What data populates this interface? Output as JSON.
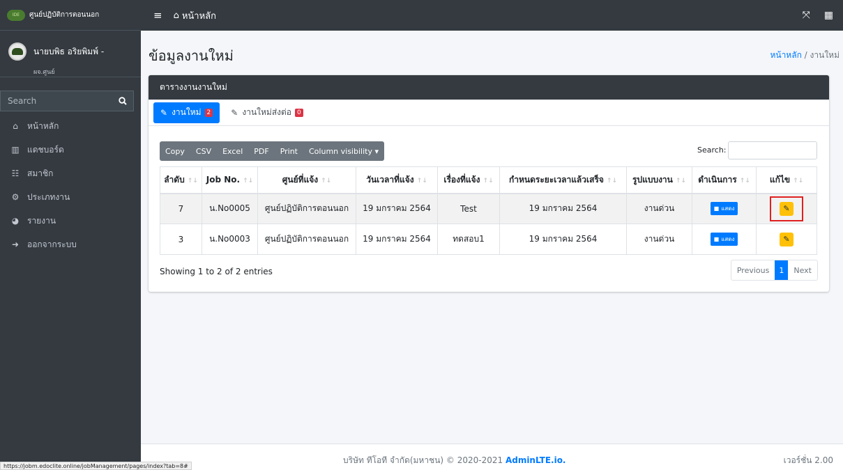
{
  "sidebar": {
    "brand": "ศูนย์ปฏิบัติการตอนนอก",
    "brand_logo_text": "IDE",
    "user_name": "นายบพิธ อริยพิมพ์ -",
    "user_role": "ผจ.ศูนย์",
    "search_placeholder": "Search",
    "items": [
      {
        "label": "หน้าหลัก",
        "icon": "home-icon"
      },
      {
        "label": "แดชบอร์ด",
        "icon": "chart-icon"
      },
      {
        "label": "สมาชิก",
        "icon": "users-icon"
      },
      {
        "label": "ประเภทงาน",
        "icon": "cogs-icon"
      },
      {
        "label": "รายงาน",
        "icon": "pie-chart-icon"
      },
      {
        "label": "ออกจากระบบ",
        "icon": "sign-out-icon"
      }
    ]
  },
  "topbar": {
    "home_label": "หน้าหลัก"
  },
  "page": {
    "title": "ข้อมูลงานใหม่",
    "breadcrumb_home": "หน้าหลัก",
    "breadcrumb_sep": " / ",
    "breadcrumb_current": "งานใหม่"
  },
  "card": {
    "title": "ตารางงานงานใหม่",
    "tabs": [
      {
        "label": "งานใหม่",
        "badge": "2",
        "active": true
      },
      {
        "label": "งานใหม่ส่งต่อ",
        "badge": "0",
        "active": false
      }
    ]
  },
  "toolbar": {
    "buttons": [
      "Copy",
      "CSV",
      "Excel",
      "PDF",
      "Print",
      "Column visibility ▾"
    ],
    "search_label": "Search:"
  },
  "table": {
    "headers": [
      "ลำดับ",
      "Job No.",
      "ศูนย์ที่แจ้ง",
      "วันเวลาที่แจ้ง",
      "เรื่องที่แจ้ง",
      "กำหนดระยะเวลาแล้วเสร็จ",
      "รูปแบบงาน",
      "ดำเนินการ",
      "แก้ไข"
    ],
    "rows": [
      {
        "no": "7",
        "job": "น.No0005",
        "center": "ศูนย์ปฏิบัติการตอนนอก",
        "date": "19 มกราคม 2564",
        "subject": "Test",
        "due": "19 มกราคม 2564",
        "type": "งานด่วน",
        "action": "แสดง"
      },
      {
        "no": "3",
        "job": "น.No0003",
        "center": "ศูนย์ปฏิบัติการตอนนอก",
        "date": "19 มกราคม 2564",
        "subject": "ทดสอบ1",
        "due": "19 มกราคม 2564",
        "type": "งานด่วน",
        "action": "แสดง"
      }
    ],
    "info": "Showing 1 to 2 of 2 entries",
    "pagination": {
      "previous": "Previous",
      "current": "1",
      "next": "Next"
    }
  },
  "footer": {
    "company": "บริษัท ทีโอที จำกัด(มหาชน) © 2020-2021 ",
    "link": "AdminLTE.io.",
    "version": "เวอร์ชั่น 2.00"
  },
  "status_url": "https://jobm.edoclite.online/jobManagement/pages/index?tab=8#",
  "colors": {
    "primary": "#007bff",
    "dark": "#343a40",
    "warning": "#ffc107",
    "danger": "#dc3545",
    "highlight": "#e02020"
  }
}
